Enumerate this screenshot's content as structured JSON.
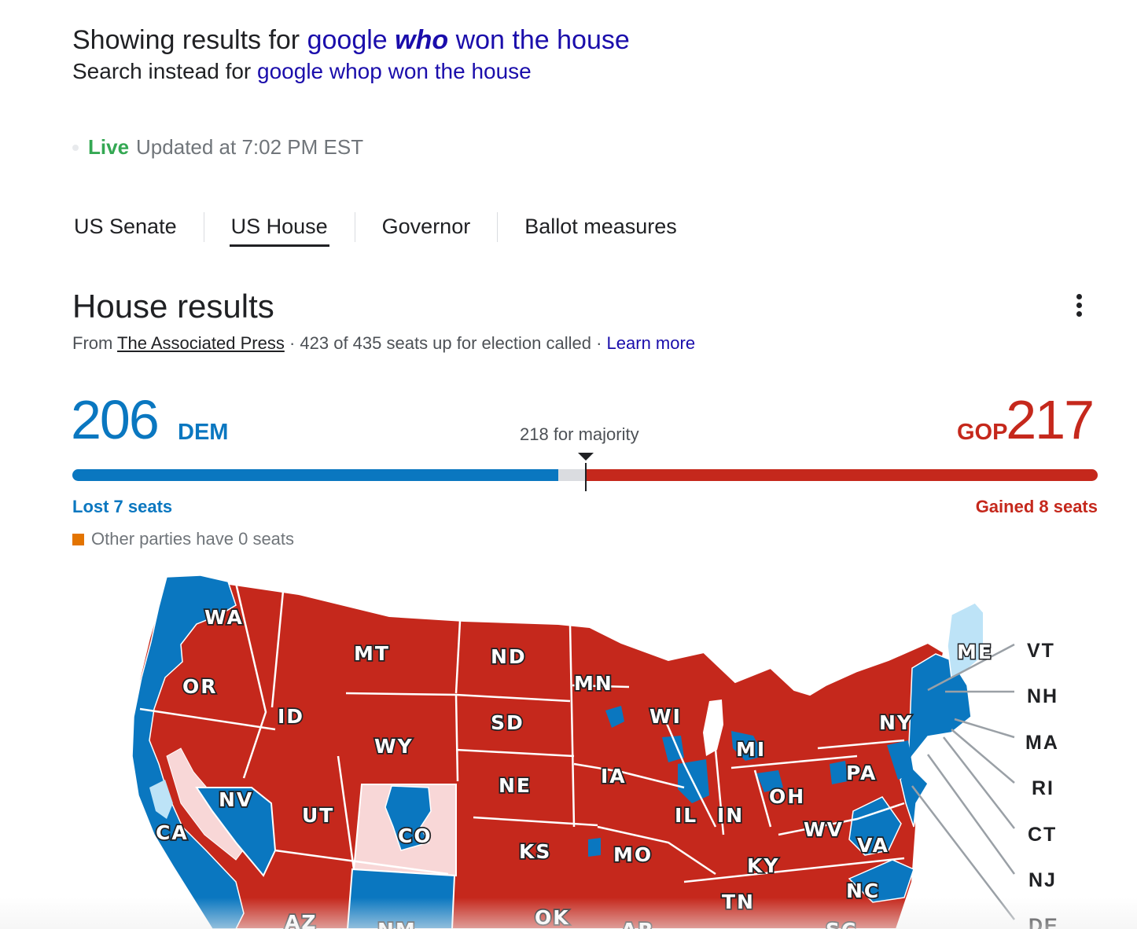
{
  "spelling": {
    "showing_prefix": "Showing results for",
    "query_before": "google",
    "query_bold": "who",
    "query_after": "won the house",
    "instead_prefix": "Search instead for",
    "instead_query": "google whop won the house"
  },
  "status": {
    "live": "Live",
    "updated": "Updated at 7:02 PM EST"
  },
  "tabs": [
    {
      "label": "US Senate",
      "active": false
    },
    {
      "label": "US House",
      "active": true
    },
    {
      "label": "Governor",
      "active": false
    },
    {
      "label": "Ballot measures",
      "active": false
    }
  ],
  "results": {
    "title": "House results",
    "from_prefix": "From",
    "source": "The Associated Press",
    "called": "· 423 of 435 seats up for election called ·",
    "learn_more": "Learn more",
    "dem": {
      "seats": "206",
      "label": "DEM",
      "change": "Lost 7 seats",
      "color": "#0a77c0"
    },
    "gop": {
      "seats": "217",
      "label": "GOP",
      "change": "Gained 8 seats",
      "color": "#c5281c"
    },
    "majority": "218 for majority",
    "other": "Other parties have 0 seats",
    "other_color": "#e37400",
    "seat_bar": {
      "total": 435,
      "dem": 206,
      "gop": 217,
      "majority": 218
    }
  },
  "map": {
    "state_labels": [
      "WA",
      "MT",
      "ND",
      "MN",
      "OR",
      "ID",
      "SD",
      "WI",
      "NY",
      "WY",
      "MI",
      "NV",
      "NE",
      "IA",
      "PA",
      "UT",
      "OH",
      "IL",
      "IN",
      "CA",
      "CO",
      "WV",
      "VA",
      "KS",
      "MO",
      "KY",
      "TN",
      "NC",
      "AZ",
      "NM",
      "OK",
      "AR",
      "SC"
    ],
    "callout_labels": [
      "ME",
      "VT",
      "NH",
      "MA",
      "RI",
      "CT",
      "NJ",
      "DE"
    ],
    "colors": {
      "dem": "#0a77c0",
      "gop": "#c5281c",
      "lean_dem": "#bde3f7",
      "lean_gop": "#f8d7d7"
    }
  }
}
